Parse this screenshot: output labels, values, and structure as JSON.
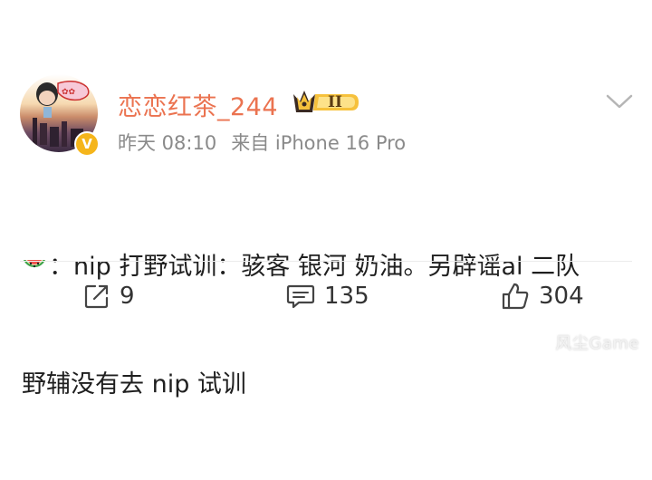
{
  "post": {
    "username": "恋恋红茶_244",
    "level_badge": "II",
    "vip_badge": "V",
    "time": "昨天 08:10",
    "source": "来自 iPhone 16 Pro",
    "content_line1": "：nip 打野试训：骇客 银河 奶油。另辟谣al 二队",
    "content_line2": "野辅没有去 nip 试训"
  },
  "actions": {
    "repost_count": "9",
    "comment_count": "135",
    "like_count": "304"
  },
  "watermark": "风尘Game",
  "icons": {
    "avatar": "avatar-image",
    "emoji": "watermelon-icon",
    "menu": "chevron-down-icon",
    "repost": "repost-icon",
    "comment": "comment-icon",
    "like": "thumbs-up-icon"
  },
  "colors": {
    "username": "#eb7350",
    "meta": "#8a8a8a",
    "vip": "#f5b51b"
  }
}
